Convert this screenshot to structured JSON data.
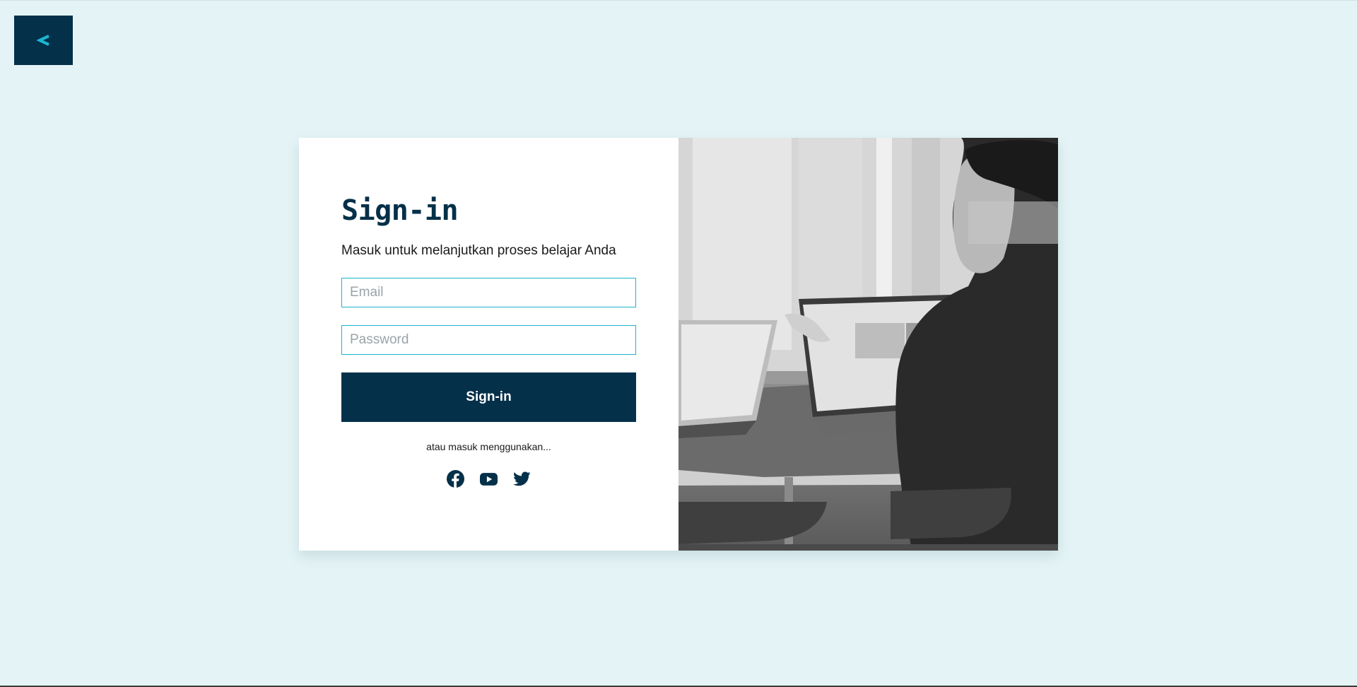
{
  "nav": {
    "back_label": "<",
    "back_icon": "chevron-left-icon",
    "back_color": "#1cb6d6"
  },
  "colors": {
    "background": "#e4f4f6",
    "primary": "#053049",
    "accent": "#19b4c9",
    "card": "#ffffff"
  },
  "signin": {
    "title": "Sign-in",
    "subtitle": "Masuk untuk melanjutkan proses belajar Anda",
    "email_placeholder": "Email",
    "password_placeholder": "Password",
    "submit_label": "Sign-in",
    "alt_text": "atau masuk menggunakan...",
    "social": [
      {
        "name": "facebook",
        "icon": "facebook-icon"
      },
      {
        "name": "youtube",
        "icon": "youtube-icon"
      },
      {
        "name": "twitter",
        "icon": "twitter-icon"
      }
    ]
  },
  "hero_image": {
    "icon": "office-photo",
    "style": "grayscale"
  }
}
